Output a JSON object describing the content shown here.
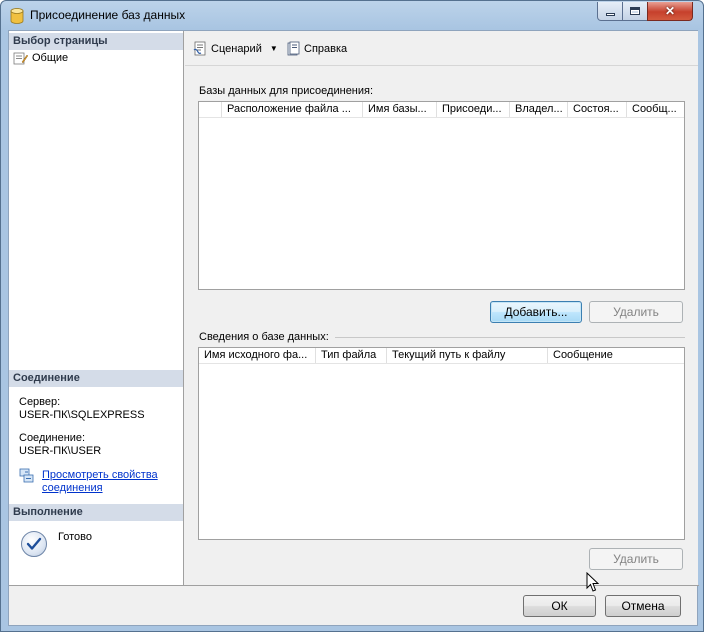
{
  "window": {
    "title": "Присоединение баз данных"
  },
  "left_panel": {
    "select_page_header": "Выбор страницы",
    "pages": [
      {
        "label": "Общие",
        "icon": "page-properties-icon"
      }
    ],
    "connection_header": "Соединение",
    "server_label": "Сервер:",
    "server_value": "USER-ПК\\SQLEXPRESS",
    "connection_label": "Соединение:",
    "connection_value": "USER-ПК\\USER",
    "view_properties_link_line1": "Просмотреть свойства",
    "view_properties_link_line2": "соединения",
    "progress_header": "Выполнение",
    "progress_status": "Готово"
  },
  "toolbar": {
    "script_label": "Сценарий",
    "help_label": "Справка"
  },
  "databases_group": {
    "label": "Базы данных для присоединения:",
    "columns": [
      "",
      "Расположение файла ...",
      "Имя базы...",
      "Присоеди...",
      "Владел...",
      "Состоя...",
      "Сообщ..."
    ],
    "add_button": "Добавить...",
    "remove_button": "Удалить"
  },
  "details_group": {
    "label": "Сведения о базе данных:",
    "columns": [
      "Имя исходного фа...",
      "Тип файла",
      "Текущий путь к файлу",
      "Сообщение"
    ],
    "remove_button": "Удалить"
  },
  "footer": {
    "ok_button": "ОК",
    "cancel_button": "Отмена"
  }
}
